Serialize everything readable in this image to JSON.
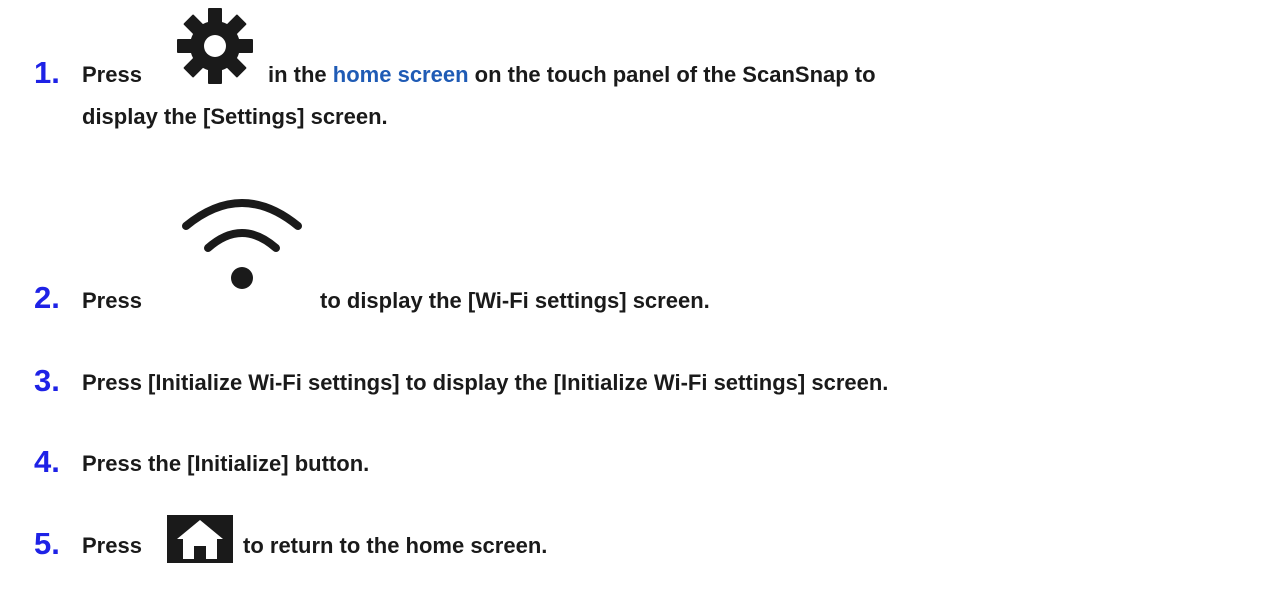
{
  "steps": [
    {
      "number": "1.",
      "press": "Press",
      "icon": "gear-icon",
      "text_before_link": "in the",
      "link": "home screen",
      "text_after_link": "on the touch panel of the ScanSnap to",
      "line2": "display the [Settings] screen."
    },
    {
      "number": "2.",
      "press": "Press",
      "icon": "wifi-icon",
      "text": "to display the [Wi-Fi settings] screen."
    },
    {
      "number": "3.",
      "text": "Press [Initialize Wi-Fi settings] to display the [Initialize Wi-Fi settings] screen."
    },
    {
      "number": "4.",
      "text": "Press the [Initialize] button."
    },
    {
      "number": "5.",
      "press": "Press",
      "icon": "home-icon",
      "text": "to return to the home screen."
    }
  ],
  "colors": {
    "step_number": "#1e22e6",
    "link": "#1f5bb5",
    "text": "#1a1a1a",
    "icon": "#1a1a1a"
  }
}
